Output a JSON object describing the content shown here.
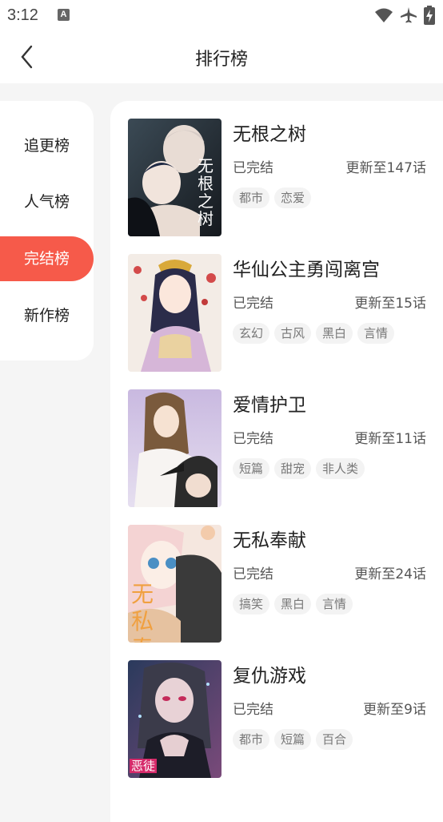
{
  "status_bar": {
    "time": "3:12",
    "notification_icon": "A"
  },
  "header": {
    "title": "排行榜",
    "back_icon": "chevron-left-icon"
  },
  "sidebar": {
    "items": [
      {
        "label": "追更榜",
        "active": false
      },
      {
        "label": "人气榜",
        "active": false
      },
      {
        "label": "完结榜",
        "active": true
      },
      {
        "label": "新作榜",
        "active": false
      }
    ]
  },
  "colors": {
    "accent": "#f65a4a",
    "tag_bg": "#f3f3f3",
    "page_bg": "#f5f5f5"
  },
  "list": [
    {
      "title": "无根之树",
      "status": "已完结",
      "update": "更新至147话",
      "tags": [
        "都市",
        "恋爱"
      ],
      "cover_text": "无根之树"
    },
    {
      "title": "华仙公主勇闯离宫",
      "status": "已完结",
      "update": "更新至15话",
      "tags": [
        "玄幻",
        "古风",
        "黑白",
        "言情"
      ]
    },
    {
      "title": "爱情护卫",
      "status": "已完结",
      "update": "更新至11话",
      "tags": [
        "短篇",
        "甜宠",
        "非人类"
      ]
    },
    {
      "title": "无私奉献",
      "status": "已完结",
      "update": "更新至24话",
      "tags": [
        "搞笑",
        "黑白",
        "言情"
      ],
      "cover_text": "无私奉献"
    },
    {
      "title": "复仇游戏",
      "status": "已完结",
      "update": "更新至9话",
      "tags": [
        "都市",
        "短篇",
        "百合"
      ],
      "cover_text": "恶徒"
    }
  ]
}
